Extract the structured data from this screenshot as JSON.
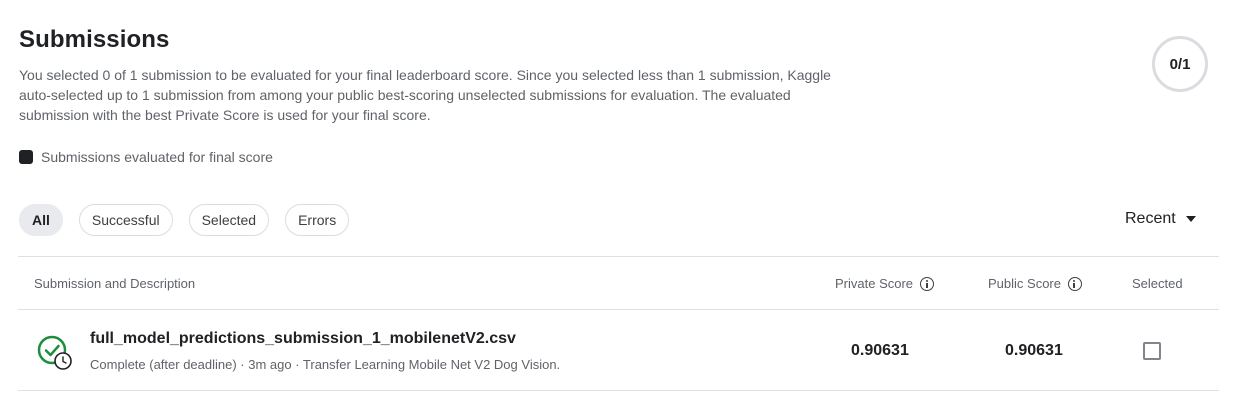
{
  "header": {
    "title": "Submissions",
    "description": "You selected 0 of 1 submission to be evaluated for your final leaderboard score. Since you selected less than 1 submission, Kaggle auto-selected up to 1 submission from among your public best-scoring unselected submissions for evaluation. The evaluated submission with the best Private Score is used for your final score.",
    "counter": "0/1"
  },
  "legend": {
    "label": "Submissions evaluated for final score"
  },
  "filters": [
    {
      "label": "All",
      "active": true
    },
    {
      "label": "Successful",
      "active": false
    },
    {
      "label": "Selected",
      "active": false
    },
    {
      "label": "Errors",
      "active": false
    }
  ],
  "sort": {
    "label": "Recent"
  },
  "table": {
    "columns": {
      "submission": "Submission and Description",
      "private": "Private Score",
      "public": "Public Score",
      "selected": "Selected"
    },
    "rows": [
      {
        "file_name": "full_model_predictions_submission_1_mobilenetV2.csv",
        "meta": "Complete (after deadline) · 3m ago · Transfer Learning Mobile Net V2 Dog Vision.",
        "private_score": "0.90631",
        "public_score": "0.90631",
        "selected": false,
        "status_icon": "check-circle-clock-icon"
      }
    ]
  },
  "colors": {
    "accent_green": "#1e8e3e",
    "text_primary": "#202124",
    "text_secondary": "#5f6368",
    "border": "#dadce0"
  }
}
